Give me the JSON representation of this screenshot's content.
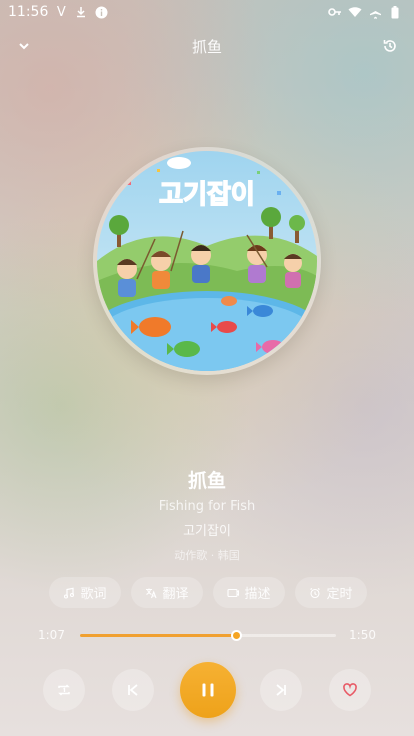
{
  "status_bar": {
    "time": "11:56",
    "left_icons": [
      "v-icon",
      "download-icon",
      "info-icon"
    ],
    "right_icons": [
      "vpn-key-icon",
      "wifi-icon",
      "airplane-icon",
      "battery-icon"
    ]
  },
  "header": {
    "title": "抓鱼",
    "left_icon": "chevron-down-icon",
    "right_icon": "history-icon"
  },
  "cover": {
    "title_text": "고기잡이"
  },
  "song": {
    "title": "抓鱼",
    "subtitle": "Fishing for Fish",
    "artist": "고기잡이",
    "meta": "动作歌 · 韩国"
  },
  "chips": [
    {
      "label": "歌词",
      "icon": "music-note-icon"
    },
    {
      "label": "翻译",
      "icon": "translate-icon"
    },
    {
      "label": "描述",
      "icon": "description-icon"
    },
    {
      "label": "定时",
      "icon": "alarm-icon"
    }
  ],
  "progress": {
    "current": "1:07",
    "total": "1:50",
    "fraction": 0.61
  },
  "controls": {
    "repeat_icon": "repeat-one-icon",
    "prev_icon": "skip-previous-icon",
    "play_state": "playing",
    "next_icon": "skip-next-icon",
    "favorite_icon": "heart-icon"
  },
  "colors": {
    "accent": "#F2A52A",
    "favorite": "#E85A66"
  }
}
